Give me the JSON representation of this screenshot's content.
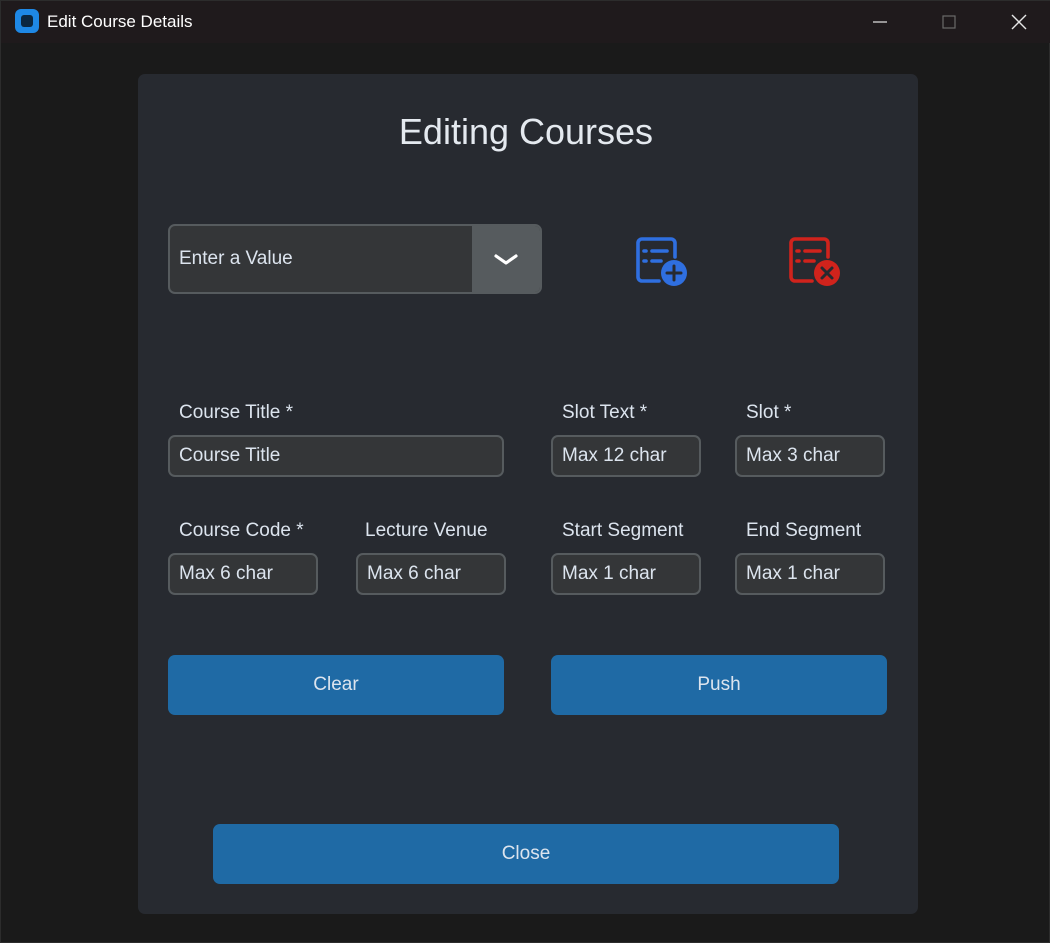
{
  "window": {
    "title": "Edit Course Details"
  },
  "heading": "Editing Courses",
  "combo": {
    "value": "Enter a Value"
  },
  "icons": {
    "add": "list-add-icon",
    "remove": "list-remove-icon",
    "add_color": "#2f6fe0",
    "remove_color": "#d0231c"
  },
  "labels": {
    "course_title": "Course Title *",
    "slot_text": "Slot Text *",
    "slot": "Slot *",
    "course_code": "Course Code *",
    "lecture_venue": "Lecture Venue",
    "start_segment": "Start Segment",
    "end_segment": "End Segment"
  },
  "placeholders": {
    "course_title": "Course Title",
    "slot_text": "Max 12 char",
    "slot": "Max 3 char",
    "course_code": "Max 6 char",
    "lecture_venue": "Max 6 char",
    "start_segment": "Max 1 char",
    "end_segment": "Max 1 char"
  },
  "buttons": {
    "clear": "Clear",
    "push": "Push",
    "close": "Close"
  },
  "colors": {
    "accent": "#1f6aa5",
    "panel": "#272a30",
    "field_border": "#565b5e"
  }
}
